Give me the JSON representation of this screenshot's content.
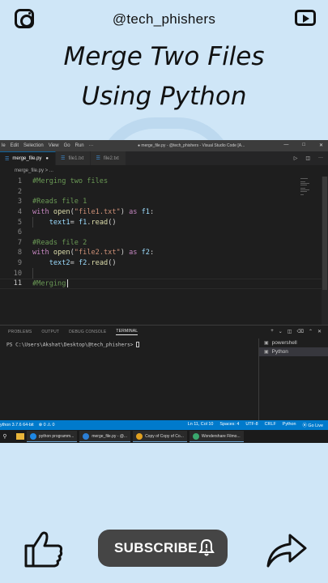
{
  "banner": {
    "handle": "@tech_phishers",
    "title_line1": "Merge Two Files",
    "title_line2": "Using Python"
  },
  "vscode": {
    "menu": [
      "le",
      "Edit",
      "Selection",
      "View",
      "Go",
      "Run",
      "···"
    ],
    "window_title": "● merge_file.py - @tech_phishers - Visual Studio Code [A...",
    "tabs": [
      {
        "label": "merge_file.py",
        "modified": "●"
      },
      {
        "label": "file1.txt"
      },
      {
        "label": "file2.txt"
      }
    ],
    "breadcrumb": "merge_file.py > ...",
    "code_lines": [
      {
        "n": "1",
        "parts": [
          {
            "t": "#Merging two files",
            "c": "c-com"
          }
        ]
      },
      {
        "n": "2",
        "parts": []
      },
      {
        "n": "3",
        "parts": [
          {
            "t": "#Reads file 1",
            "c": "c-com"
          }
        ]
      },
      {
        "n": "4",
        "parts": [
          {
            "t": "with",
            "c": "c-kw"
          },
          {
            "t": " ",
            "c": "c-pl"
          },
          {
            "t": "open",
            "c": "c-fn"
          },
          {
            "t": "(",
            "c": "c-pl"
          },
          {
            "t": "\"file1.txt\"",
            "c": "c-str"
          },
          {
            "t": ") ",
            "c": "c-pl"
          },
          {
            "t": "as",
            "c": "c-kw"
          },
          {
            "t": " ",
            "c": "c-pl"
          },
          {
            "t": "f1",
            "c": "c-var"
          },
          {
            "t": ":",
            "c": "c-pl"
          }
        ]
      },
      {
        "n": "5",
        "parts": [
          {
            "t": "    ",
            "c": "c-pl"
          },
          {
            "t": "text1",
            "c": "c-var"
          },
          {
            "t": "= ",
            "c": "c-pl"
          },
          {
            "t": "f1",
            "c": "c-var"
          },
          {
            "t": ".",
            "c": "c-pl"
          },
          {
            "t": "read",
            "c": "c-fn"
          },
          {
            "t": "()",
            "c": "c-pl"
          }
        ]
      },
      {
        "n": "6",
        "parts": []
      },
      {
        "n": "7",
        "parts": [
          {
            "t": "#Reads file 2",
            "c": "c-com"
          }
        ]
      },
      {
        "n": "8",
        "parts": [
          {
            "t": "with",
            "c": "c-kw"
          },
          {
            "t": " ",
            "c": "c-pl"
          },
          {
            "t": "open",
            "c": "c-fn"
          },
          {
            "t": "(",
            "c": "c-pl"
          },
          {
            "t": "\"file2.txt\"",
            "c": "c-str"
          },
          {
            "t": ") ",
            "c": "c-pl"
          },
          {
            "t": "as",
            "c": "c-kw"
          },
          {
            "t": " ",
            "c": "c-pl"
          },
          {
            "t": "f2",
            "c": "c-var"
          },
          {
            "t": ":",
            "c": "c-pl"
          }
        ]
      },
      {
        "n": "9",
        "parts": [
          {
            "t": "    ",
            "c": "c-pl"
          },
          {
            "t": "text2",
            "c": "c-var"
          },
          {
            "t": "= ",
            "c": "c-pl"
          },
          {
            "t": "f2",
            "c": "c-var"
          },
          {
            "t": ".",
            "c": "c-pl"
          },
          {
            "t": "read",
            "c": "c-fn"
          },
          {
            "t": "()",
            "c": "c-pl"
          }
        ]
      },
      {
        "n": "10",
        "parts": []
      },
      {
        "n": "11",
        "parts": [
          {
            "t": "#Merging",
            "c": "c-com"
          }
        ],
        "current": true
      }
    ],
    "panel_tabs": [
      "PROBLEMS",
      "OUTPUT",
      "DEBUG CONSOLE",
      "TERMINAL"
    ],
    "terminal_prompt": "PS C:\\Users\\Akshat\\Desktop\\@tech_phishers> ",
    "terminal_list": [
      "powershell",
      "Python"
    ],
    "status_left": [
      "ython 3.7.6 64-bit",
      "⊗ 0 ⚠ 0"
    ],
    "status_right": [
      "Ln 11, Col 10",
      "Spaces: 4",
      "UTF-8",
      "CRLF",
      "Python",
      "Go Live"
    ],
    "taskbar": [
      {
        "label": "python programm...",
        "color": "#1e88e5"
      },
      {
        "label": "merge_file.py - @...",
        "color": "#2b7fd6"
      },
      {
        "label": "Copy of Copy of Co...",
        "color": "#e0a020"
      },
      {
        "label": "Wondershare Filmo...",
        "color": "#3aa86e"
      }
    ]
  },
  "subscribe_label": "SUBSCRIBE"
}
